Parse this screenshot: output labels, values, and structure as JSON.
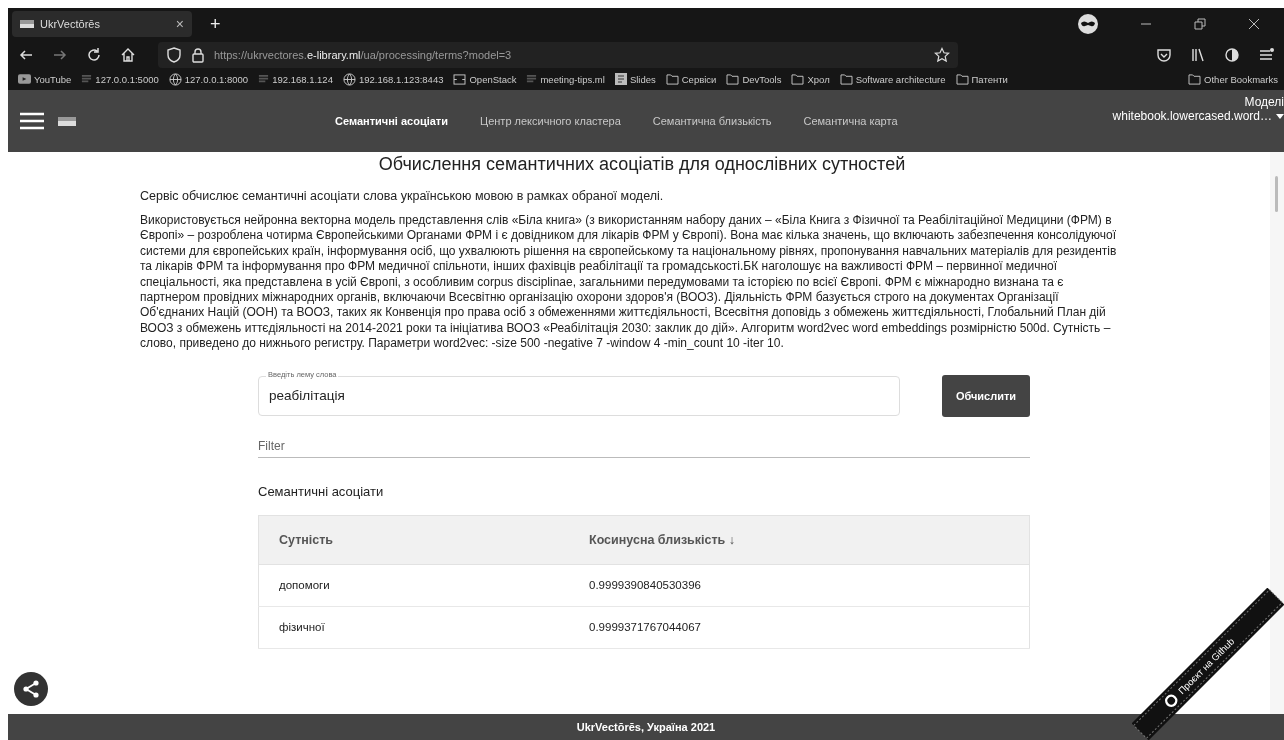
{
  "browser": {
    "tab_title": "UkrVectōrēs",
    "tab_close": "×",
    "new_tab": "+",
    "url": "https://ukrvectores.**e-library.ml**/ua/processing/terms?model=3",
    "bookmarks": [
      {
        "kind": "video",
        "label": "YouTube"
      },
      {
        "kind": "page",
        "label": "127.0.0.1:5000"
      },
      {
        "kind": "globe",
        "label": "127.0.0.1:8000"
      },
      {
        "kind": "page",
        "label": "192.168.1.124"
      },
      {
        "kind": "globe",
        "label": "192.168.1.123:8443"
      },
      {
        "kind": "stack",
        "label": "OpenStack"
      },
      {
        "kind": "page",
        "label": "meeting-tips.ml"
      },
      {
        "kind": "slides",
        "label": "Slides"
      },
      {
        "kind": "folder",
        "label": "Сервіси"
      },
      {
        "kind": "folder",
        "label": "DevTools"
      },
      {
        "kind": "folder",
        "label": "Хрол"
      },
      {
        "kind": "folder",
        "label": "Software architecture"
      },
      {
        "kind": "folder",
        "label": "Патенти"
      }
    ],
    "other_bookmarks": "Other Bookmarks"
  },
  "navbar": {
    "tabs": [
      {
        "label": "Семантичні асоціати",
        "selected": true
      },
      {
        "label": "Центр лексичного кластера",
        "selected": false
      },
      {
        "label": "Семантична близькість",
        "selected": false
      },
      {
        "label": "Семантична карта",
        "selected": false
      }
    ],
    "model_label": "Моделі",
    "model_value": "whitebook.lowercased.word…"
  },
  "heading": "Обчислення семантичних асоціатів для однослівних сутностей",
  "intro": "Сервіс обчислює семантичні асоціати слова українською мовою в рамках обраної моделі.",
  "description": "Використовується нейронна векторна модель представлення слів «Біла книга» (з використанням набору даних – «Біла Книга з Фізичної та Реабілітаційної Медицини (ФРМ) в Європі» – розроблена чотирма Європейськими Органами ФРМ і є довідником для лікарів ФРМ у Європі). Вона має кілька значень, що включають забезпечення консолідуючої системи для європейських країн, інформування осіб, що ухвалюють рішення на європейському та національному рівнях, пропонування навчальних матеріалів для резидентів та лікарів ФРМ та інформування про ФРМ медичної спільноти, інших фахівців реабілітації та громадськості.БК наголошує на важливості ФРМ – первинної медичної спеціальності, яка представлена в усій Європі, з особливим corpus disciplinae, загальними передумовами та історією по всієї Європі. ФРМ є міжнародно визнана та є партнером провідних міжнародних органів, включаючи Всесвітню організацію охорони здоров'я (ВООЗ). Діяльність ФРМ базується строго на документах Організації Об'єднаних Націй (ООН) та ВООЗ, таких як Конвенція про права осіб з обмеженнями життєдіяльності, Всесвітня доповідь з обмежень життєдіяльності, Глобальний План дій ВООЗ з обмежень иттєдіяльності на 2014-2021 роки та ініціатива ВООЗ «Реабілітація 2030: заклик до дій». Алгоритм word2vec word embeddings розмірністю 500d. Сутність – слово, приведено до нижнього регистру. Параметри word2vec: -size 500 -negative 7 -window 4 -min_count 10 -iter 10.",
  "lemma_field": {
    "label": "Введіть лему слова",
    "value": "реабілітація"
  },
  "compute_button": "Обчислити",
  "filter": {
    "placeholder": "Filter"
  },
  "results_title": "Семантичні асоціати",
  "table": {
    "columns": [
      "Сутність",
      "Косинусна близькість ↓"
    ],
    "rows": [
      [
        "допомоги",
        "0.9999390840530396"
      ],
      [
        "фізичної",
        "0.9999371767044067"
      ]
    ]
  },
  "footer": "UkrVectōrēs, Україна 2021",
  "ribbon": "Проєкт на Github"
}
